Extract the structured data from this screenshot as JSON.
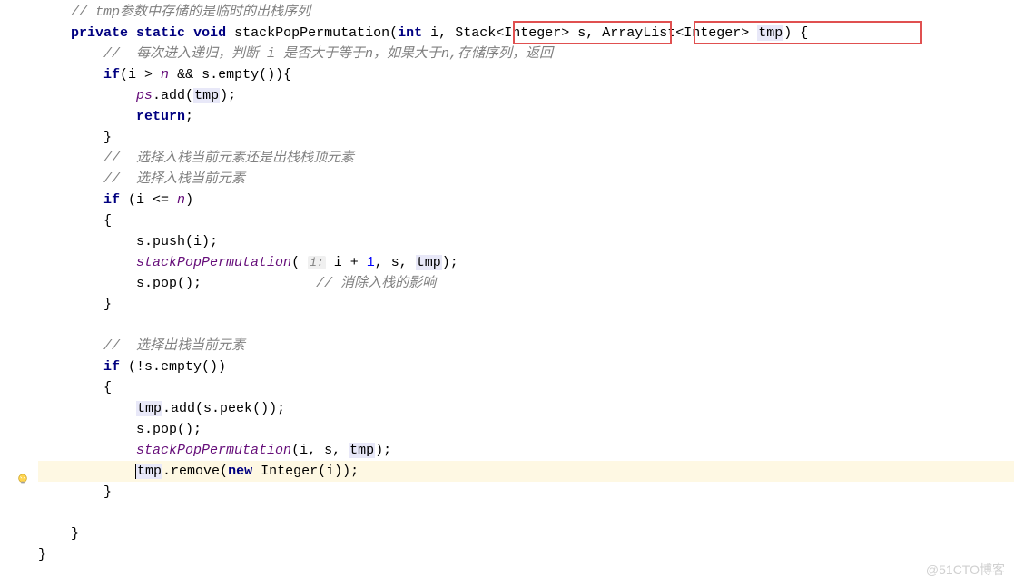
{
  "code": {
    "comment1": "// tmp参数中存储的是临时的出栈序列",
    "kw_private": "private",
    "kw_static": "static",
    "kw_void": "void",
    "method_name": "stackPopPermutation",
    "param_open": "(",
    "kw_int": "int",
    "param_i": " i, ",
    "type_stack": "Stack<Integer> s",
    "comma2": ", ",
    "type_arraylist": "ArrayList<Integer> ",
    "param_tmp": "tmp",
    "param_close": ") {",
    "comment2": "//  每次进入递归，判断 i 是否大于等于n，如果大于n,存储序列，返回",
    "kw_if": "if",
    "cond1_open": "(i > ",
    "var_n": "n",
    "cond1_mid": " && s.empty()){",
    "var_ps": "ps",
    "add_call": ".add(",
    "var_tmp_boxed": "tmp",
    "close_paren_semi": ");",
    "kw_return": "return",
    "semi": ";",
    "close_brace": "}",
    "comment3": "//  选择入栈当前元素还是出栈栈顶元素",
    "comment4": "//  选择入栈当前元素",
    "cond2": " (i <= ",
    "cond2_close": ")",
    "open_brace": "{",
    "push_call": "s.push(i);",
    "recurse1_name": "stackPopPermutation",
    "recurse1_open": "( ",
    "hint_i": "i:",
    "recurse1_expr": " i + ",
    "num_1": "1",
    "recurse1_mid": ", s, ",
    "pop_call": "s.pop();",
    "pop_spaces": "              ",
    "comment5": "// 消除入栈的影响",
    "comment6": "//  选择出栈当前元素",
    "cond3": " (!s.empty())",
    "tmp_add": ".add(s.peek());",
    "recurse2": "(i, s, ",
    "remove_open": ".remove(",
    "kw_new": "new",
    "integer_call": " Integer(i));"
  },
  "watermark": "@51CTO博客"
}
